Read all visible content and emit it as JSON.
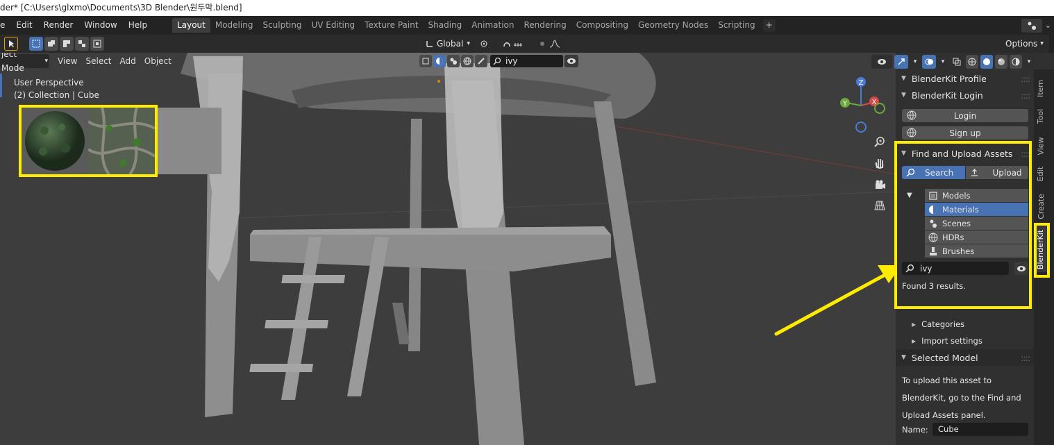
{
  "window": {
    "title": "der* [C:\\Users\\glxmo\\Documents\\3D Blender\\원두막.blend]"
  },
  "menu": {
    "items": [
      "e",
      "Edit",
      "Render",
      "Window",
      "Help"
    ]
  },
  "workspaces": {
    "tabs": [
      "Layout",
      "Modeling",
      "Sculpting",
      "UV Editing",
      "Texture Paint",
      "Shading",
      "Animation",
      "Rendering",
      "Compositing",
      "Geometry Nodes",
      "Scripting"
    ],
    "active": "Layout",
    "add": "+"
  },
  "tool_header": {
    "orientation": "Global",
    "options": "Options",
    "search_value": "ivy"
  },
  "viewport": {
    "mode": "Object Mode",
    "mode_visible": "ject Mode",
    "menus": [
      "View",
      "Select",
      "Add",
      "Object"
    ],
    "perspective": "User Perspective",
    "collection": "(2) Collection | Cube",
    "gizmo_axes": {
      "x": "X",
      "y": "Y",
      "z": "Z"
    }
  },
  "sidebar": {
    "profile_title": "BlenderKit Profile",
    "login_title": "BlenderKit Login",
    "login_button": "Login",
    "signup_button": "Sign up",
    "find_title": "Find and Upload Assets",
    "search_tab": "Search",
    "upload_tab": "Upload",
    "asset_types": [
      {
        "label": "Models",
        "icon": "cube-icon",
        "active": false
      },
      {
        "label": "Materials",
        "icon": "material-sphere-icon",
        "active": true
      },
      {
        "label": "Scenes",
        "icon": "scene-icon",
        "active": false
      },
      {
        "label": "HDRs",
        "icon": "world-icon",
        "active": false
      },
      {
        "label": "Brushes",
        "icon": "brush-icon",
        "active": false
      }
    ],
    "search_value": "ivy",
    "results_text": "Found 3 results.",
    "categories": "Categories",
    "import_settings": "Import settings",
    "selected_model_title": "Selected Model",
    "upload_info": [
      "To upload this asset to",
      "BlenderKit, go to the Find and",
      "Upload Assets panel."
    ],
    "name_label": "Name:",
    "name_value": "Cube"
  },
  "vertical_tabs": [
    "Item",
    "Tool",
    "View",
    "Edit",
    "Create",
    "BlenderKit"
  ],
  "colors": {
    "highlight": "#ffeb00",
    "accent": "#4772b3",
    "panel": "#303030",
    "button": "#545454"
  }
}
